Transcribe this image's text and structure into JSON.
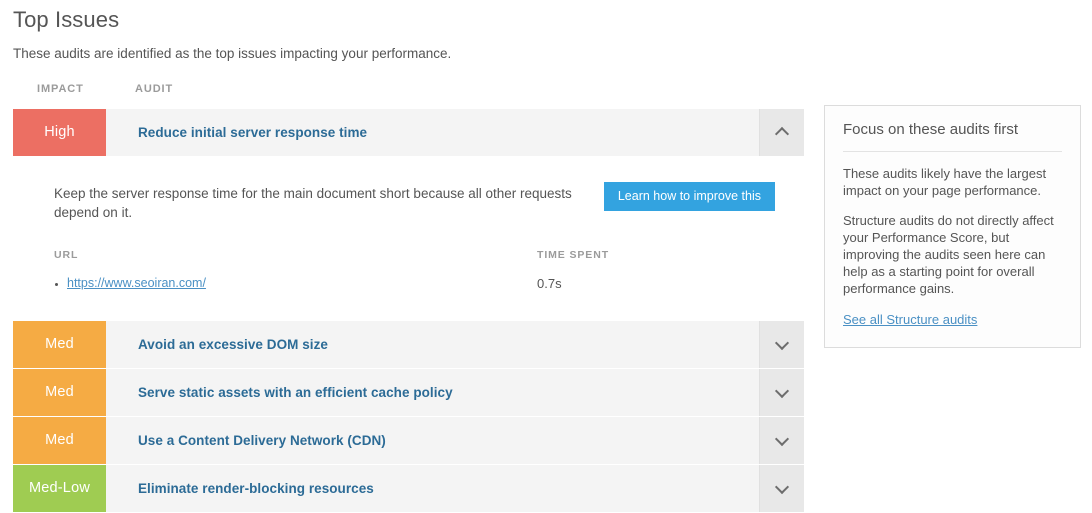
{
  "header": {
    "title": "Top Issues",
    "subtitle": "These audits are identified as the top issues impacting your performance."
  },
  "table": {
    "columns": {
      "impact": "IMPACT",
      "audit": "AUDIT"
    },
    "rows": [
      {
        "impact_label": "High",
        "impact_level": "high",
        "title": "Reduce initial server response time",
        "expanded": true,
        "chevron": "chevron-up-icon",
        "detail": {
          "description": "Keep the server response time for the main document short because all other requests depend on it.",
          "button_label": "Learn how to improve this",
          "columns": {
            "url": "URL",
            "time_spent": "TIME SPENT"
          },
          "entries": [
            {
              "url": "https://www.seoiran.com/",
              "time_spent": "0.7s"
            }
          ]
        }
      },
      {
        "impact_label": "Med",
        "impact_level": "med",
        "title": "Avoid an excessive DOM size",
        "expanded": false,
        "chevron": "chevron-down-icon"
      },
      {
        "impact_label": "Med",
        "impact_level": "med",
        "title": "Serve static assets with an efficient cache policy",
        "expanded": false,
        "chevron": "chevron-down-icon"
      },
      {
        "impact_label": "Med",
        "impact_level": "med",
        "title": "Use a Content Delivery Network (CDN)",
        "expanded": false,
        "chevron": "chevron-down-icon"
      },
      {
        "impact_label": "Med-Low",
        "impact_level": "medlow",
        "title": "Eliminate render-blocking resources",
        "expanded": false,
        "chevron": "chevron-down-icon"
      }
    ]
  },
  "side_card": {
    "title": "Focus on these audits first",
    "paragraph_1": "These audits likely have the largest impact on your page performance.",
    "paragraph_2": "Structure audits do not directly affect your Performance Score, but improving the audits seen here can help as a starting point for overall performance gains.",
    "link_label": "See all Structure audits"
  },
  "colors": {
    "impact_high": "#ec6f63",
    "impact_med": "#f5ab44",
    "impact_medlow": "#9fcc52",
    "audit_link": "#2c6b96",
    "button_blue": "#33a3e0",
    "row_background": "#f4f4f4",
    "chevron_cell": "#e8e8e8"
  }
}
